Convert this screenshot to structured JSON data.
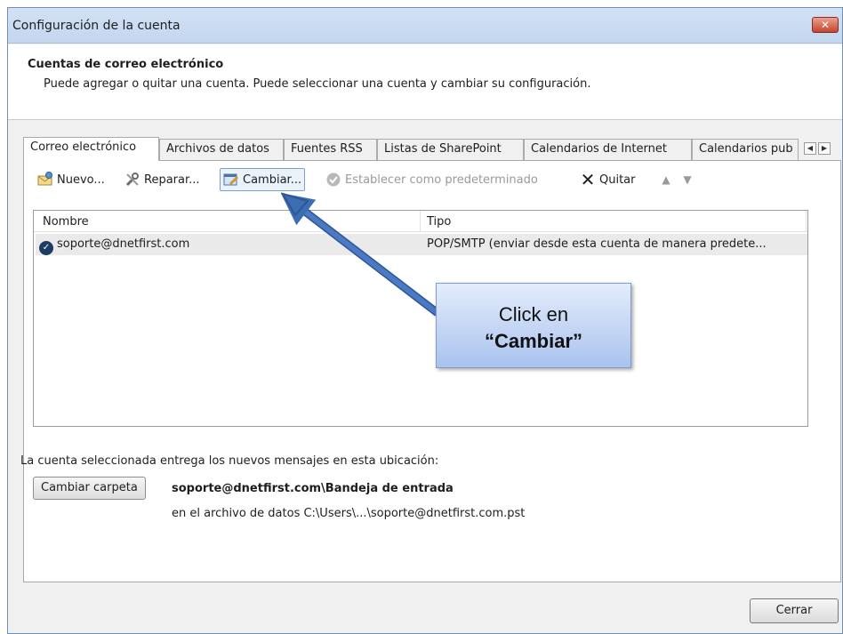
{
  "window": {
    "title": "Configuración de la cuenta",
    "close_glyph": "✕"
  },
  "header": {
    "title": "Cuentas de correo electrónico",
    "subtitle": "Puede agregar o quitar una cuenta. Puede seleccionar una cuenta y cambiar su configuración."
  },
  "tabs": [
    {
      "label": "Correo electrónico",
      "active": true
    },
    {
      "label": "Archivos de datos"
    },
    {
      "label": "Fuentes RSS"
    },
    {
      "label": "Listas de SharePoint"
    },
    {
      "label": "Calendarios de Internet"
    },
    {
      "label": "Calendarios pub"
    }
  ],
  "toolbar": {
    "new_label": "Nuevo...",
    "repair_label": "Reparar...",
    "change_label": "Cambiar...",
    "default_label": "Establecer como predeterminado",
    "remove_label": "Quitar",
    "icons": [
      "new-account-icon",
      "repair-icon",
      "change-icon",
      "default-check-icon",
      "remove-x-icon",
      "up-arrow-icon",
      "down-arrow-icon"
    ]
  },
  "list": {
    "col_name": "Nombre",
    "col_type": "Tipo",
    "rows": [
      {
        "name": "soporte@dnetfirst.com",
        "type": "POP/SMTP (enviar desde esta cuenta de manera predete..."
      }
    ]
  },
  "delivery": {
    "label": "La cuenta seleccionada entrega los nuevos mensajes en esta ubicación:",
    "change_folder_label": "Cambiar carpeta",
    "path": "soporte@dnetfirst.com\\Bandeja de entrada",
    "file": "en el archivo de datos C:\\Users\\...\\soporte@dnetfirst.com.pst"
  },
  "close_label": "Cerrar",
  "callout": {
    "line1": "Click en",
    "line2": "“Cambiar”"
  },
  "colors": {
    "accent": "#3d6db3",
    "callout_fill": "#a9c3ee",
    "close_red": "#c7452d"
  }
}
